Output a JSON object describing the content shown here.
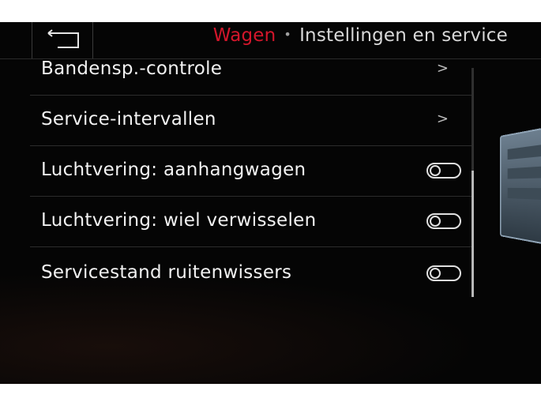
{
  "header": {
    "category": "Wagen",
    "separator": "•",
    "title": "Instellingen en service",
    "back_icon": "back-arrow-icon"
  },
  "list": {
    "items": [
      {
        "label": "Bandensp.-controle",
        "control": "chevron",
        "chevron": ">"
      },
      {
        "label": "Service-intervallen",
        "control": "chevron",
        "chevron": ">"
      },
      {
        "label": "Luchtvering: aanhangwagen",
        "control": "toggle",
        "state": "off"
      },
      {
        "label": "Luchtvering: wiel verwisselen",
        "control": "toggle",
        "state": "off"
      },
      {
        "label": "Servicestand ruitenwissers",
        "control": "toggle",
        "state": "off"
      }
    ]
  },
  "colors": {
    "accent": "#d3162b",
    "text": "#f2f2f2",
    "background": "#050505"
  }
}
